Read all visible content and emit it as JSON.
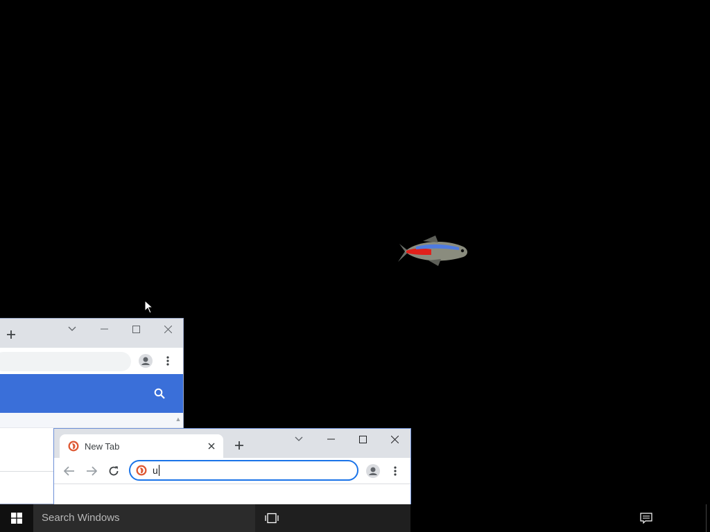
{
  "desktop": {
    "background_color": "#000000",
    "screensaver": "neon-tetra-fish"
  },
  "back_window": {
    "caption_icons": [
      "chevron-down-icon",
      "minimize-icon",
      "maximize-icon",
      "close-icon"
    ],
    "accent_color": "#3a6fd9"
  },
  "front_window": {
    "tab": {
      "title": "New Tab",
      "favicon": "duckduckgo-icon"
    },
    "omnibox": {
      "value": "u"
    },
    "accent_color": "#1a73e8"
  },
  "taskbar": {
    "search_placeholder": "Search Windows"
  }
}
